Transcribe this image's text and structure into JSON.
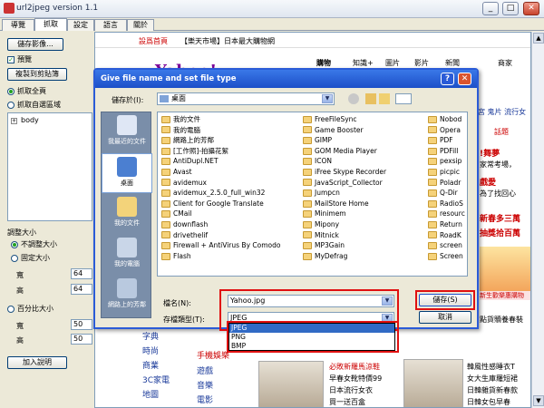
{
  "window": {
    "title": "url2jpeg version 1.1",
    "min": "_",
    "max": "□",
    "close": "✕"
  },
  "tabs": [
    "導覽",
    "抓取",
    "設定",
    "語言",
    "關於"
  ],
  "left": {
    "save_image": "儲存影像...",
    "preview": "預覽",
    "copy_clipboard": "複製到剪貼簿",
    "grab_full": "抓取全頁",
    "grab_custom": "抓取自選區域",
    "tree_node": "body",
    "resize_title": "調整大小",
    "no_resize": "不調整大小",
    "fixed_size": "固定大小",
    "width_label": "寬",
    "width_value": "64",
    "height_label": "高",
    "height_value": "64",
    "percent": "百分比大小",
    "pwidth_label": "寬",
    "pwidth_value": "50",
    "pheight_label": "高",
    "pheight_value": "50",
    "add_note": "加入說明"
  },
  "browser": {
    "topbar_home": "設爲首頁",
    "topbar_text": "【樂天市場】日本最大購物網",
    "nav": [
      "購物",
      "知識+",
      "圖片",
      "影片",
      "新聞",
      "商家"
    ],
    "right_links": [
      "宮 鬼片 流行女"
    ],
    "topic": "話題",
    "r1": "!舞夢",
    "r2": "家常考場，",
    "r3": "戲愛",
    "r4": "為了找回心",
    "r5": "新春多三萬",
    "r6": "抽獎拾百萬",
    "sale": "新生歡樂惠購物",
    "bottom_r": "點貨贖養春裝",
    "left_list": [
      "字典",
      "時尚",
      "商業",
      "3C家電",
      "地圖"
    ],
    "mid_list": [
      "遊戲",
      "音樂",
      "電影"
    ],
    "mobile": "手機娛樂",
    "news": [
      "必敗新羅馬涼鞋",
      "早春女靴特價99",
      "日本流行女衣",
      "買一送百盒"
    ],
    "news2": [
      "韓風性感睡衣T",
      "女大生庫羅短裙",
      "日韓雜貨新春款",
      "日韓女包早春"
    ]
  },
  "dialog": {
    "title": "Give file name and set file type",
    "save_in_label": "儲存於(I):",
    "save_in_value": "桌面",
    "places": [
      "我最近的文件",
      "桌面",
      "我的文件",
      "我的電腦",
      "網路上的芳鄰"
    ],
    "col1": [
      "我的文件",
      "我的電腦",
      "網路上的芳鄰",
      "[工作照]-拍攝花絮",
      "AntiDupl.NET",
      "Avast",
      "avidemux",
      "avidemux_2.5.0_full_win32",
      "Client for Google Translate",
      "CMail",
      "downflash",
      "drivethelif",
      "Firewall + AntiVirus By Comodo",
      "Flash"
    ],
    "col2": [
      "FreeFileSync",
      "Game Booster",
      "GIMP",
      "GOM Media Player",
      "ICON",
      "iFree Skype Recorder",
      "JavaScript_Collector",
      "Jumpcn",
      "MailStore Home",
      "Minimem",
      "Mipony",
      "Mitnick",
      "MP3Gain",
      "MyDefrag"
    ],
    "col3": [
      "Nobod",
      "Opera",
      "PDF",
      "PDFill",
      "pexsip",
      "picpic",
      "Poladr",
      "Q-Dir",
      "RadioS",
      "resourc",
      "Return",
      "RoadK",
      "screen",
      "Screen"
    ],
    "filename_label": "檔名(N):",
    "filename_value": "Yahoo.jpg",
    "filetype_label": "存檔類型(T):",
    "filetype_value": "JPEG",
    "save_button": "儲存(S)",
    "cancel_button": "取消",
    "type_options": [
      "JPEG",
      "PNG",
      "BMP"
    ]
  }
}
